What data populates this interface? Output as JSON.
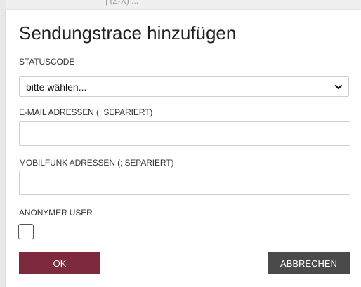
{
  "background": {
    "ghost_text": "| (Z-X) ..."
  },
  "dialog": {
    "title": "Sendungstrace hinzufügen",
    "statuscode": {
      "label": "STATUSCODE",
      "selected": "bitte wählen..."
    },
    "email": {
      "label": "E-MAIL ADRESSEN (; SEPARIERT)",
      "value": ""
    },
    "mobile": {
      "label": "MOBILFUNK ADRESSEN (; SEPARIERT)",
      "value": ""
    },
    "anonymous": {
      "label": "ANONYMER USER",
      "checked": false
    },
    "buttons": {
      "ok": "OK",
      "cancel": "ABBRECHEN"
    }
  },
  "colors": {
    "ok_button": "#7c2a3c",
    "cancel_button": "#4a4a4a"
  },
  "icons": {
    "select_arrow": "chevron-down-icon"
  }
}
